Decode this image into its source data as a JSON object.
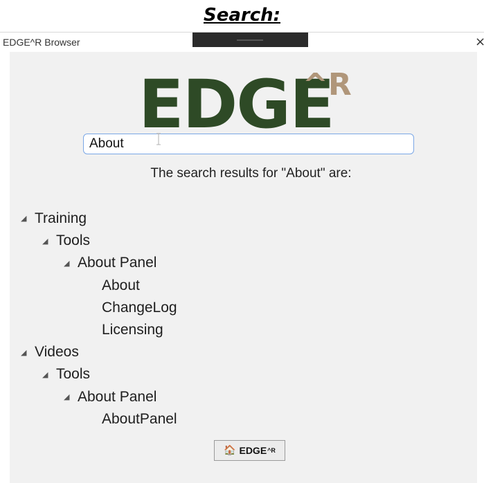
{
  "heading": "Search:",
  "window": {
    "title": "EDGE^R Browser",
    "close_glyph": "×"
  },
  "logo": {
    "main": "EDGE",
    "sup": "^R"
  },
  "search": {
    "value": "About"
  },
  "results_label": "The search results for \"About\" are:",
  "tree": [
    {
      "label": "Training",
      "depth": 0,
      "expanded": true
    },
    {
      "label": "Tools",
      "depth": 1,
      "expanded": true
    },
    {
      "label": "About Panel",
      "depth": 2,
      "expanded": true
    },
    {
      "label": "About",
      "depth": 3,
      "expanded": false
    },
    {
      "label": "ChangeLog",
      "depth": 3,
      "expanded": false
    },
    {
      "label": "Licensing",
      "depth": 3,
      "expanded": false
    },
    {
      "label": "Videos",
      "depth": 0,
      "expanded": true
    },
    {
      "label": "Tools",
      "depth": 1,
      "expanded": true
    },
    {
      "label": "About Panel",
      "depth": 2,
      "expanded": true
    },
    {
      "label": "AboutPanel",
      "depth": 3,
      "expanded": false
    }
  ],
  "home_button": {
    "label": "EDGE",
    "sup": "^R",
    "icon": "home-icon"
  },
  "colors": {
    "logo_green": "#2e4a26",
    "logo_tan": "#b0967a",
    "input_border": "#7aa7e6",
    "panel_bg": "#f1f1f1"
  }
}
